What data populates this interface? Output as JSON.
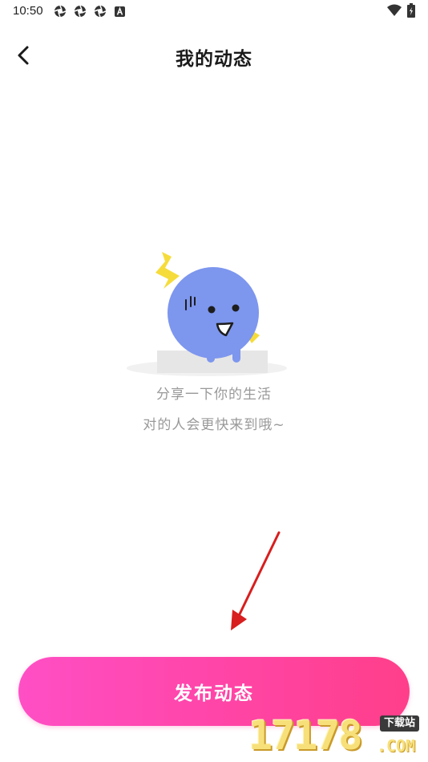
{
  "status_bar": {
    "time": "10:50",
    "left_icons": [
      "aperture-icon",
      "aperture-icon",
      "aperture-icon",
      "a-badge-icon"
    ],
    "right_icons": [
      "wifi-icon",
      "battery-icon"
    ]
  },
  "header": {
    "title": "我的动态",
    "back_icon": "chevron-left-icon"
  },
  "empty_state": {
    "illustration": "blue-blob-mascot-with-lightning",
    "line1": "分享一下你的生活",
    "line2": "对的人会更快来到哦~"
  },
  "annotation": {
    "arrow_color": "#d81e1e"
  },
  "publish_button": {
    "label": "发布动态"
  },
  "watermark": {
    "number": "17178",
    "tag": "下载站",
    "domain": ".COM"
  },
  "colors": {
    "button_gradient_start": "#ff4fc5",
    "button_gradient_end": "#ff3f8a",
    "mascot_blue": "#7d96ee",
    "lightning_yellow": "#f6dc3a",
    "hint_text": "#999999"
  }
}
